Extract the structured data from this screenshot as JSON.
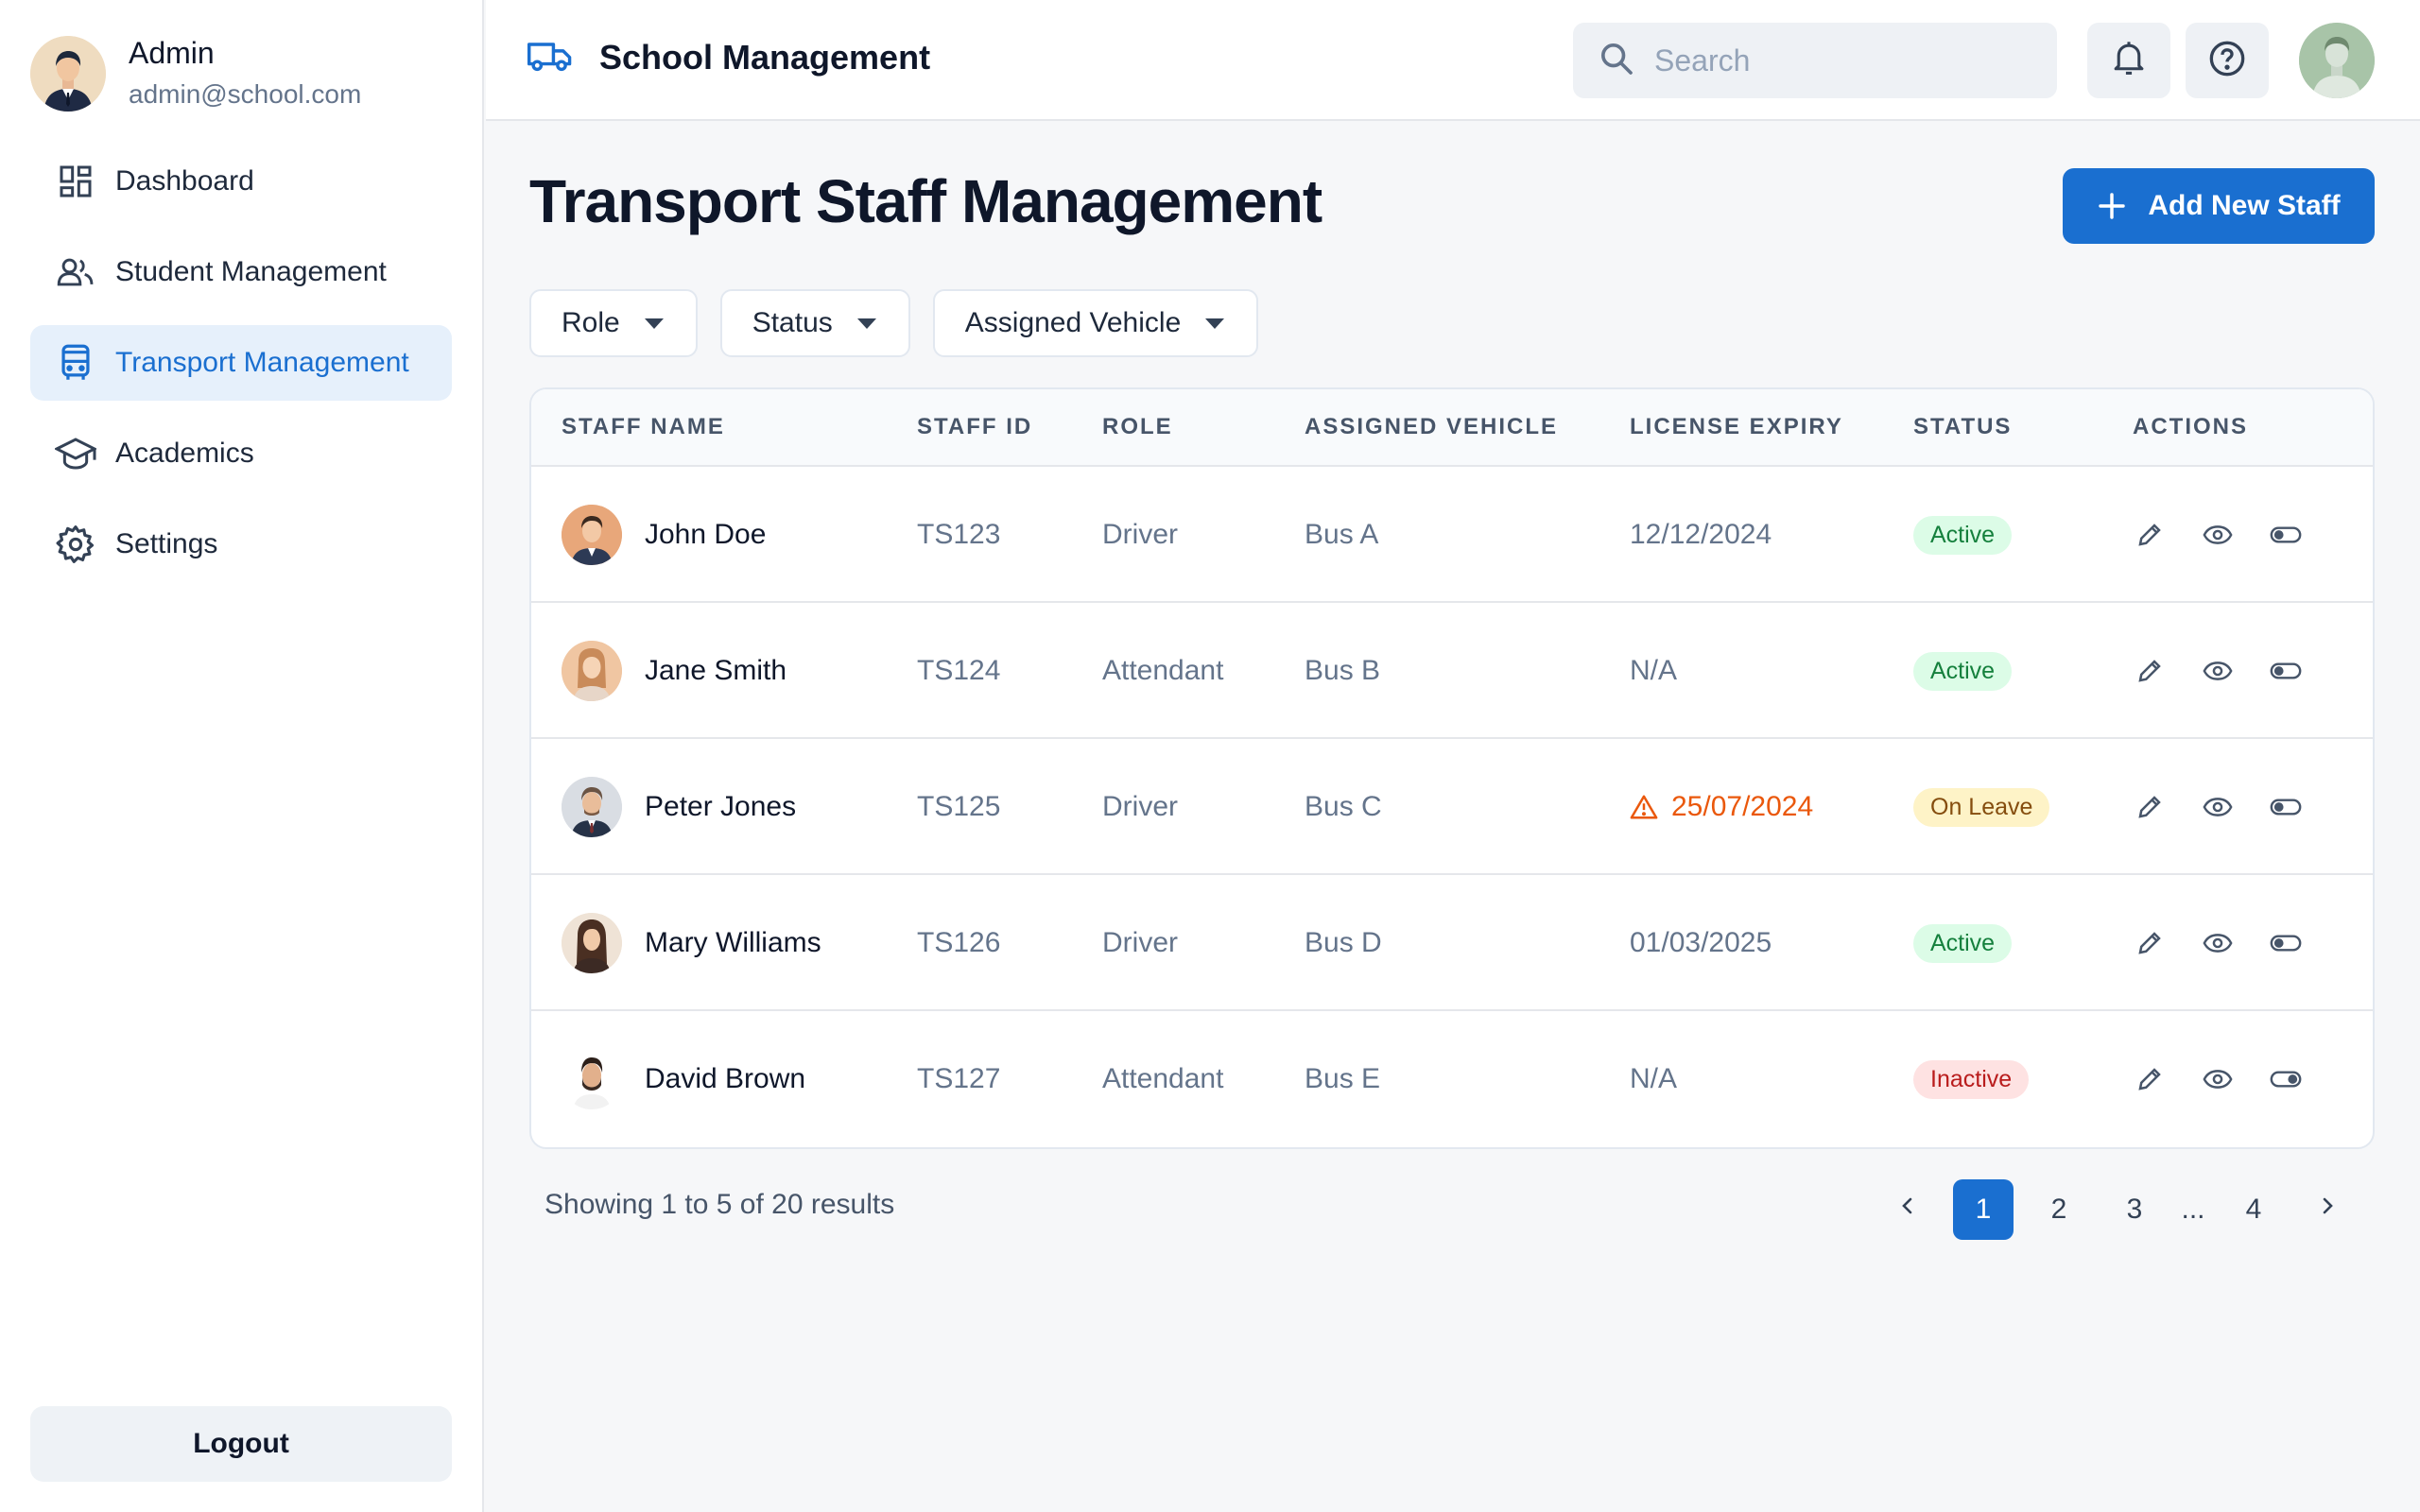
{
  "sidebar": {
    "user": {
      "name": "Admin",
      "email": "admin@school.com"
    },
    "items": [
      {
        "label": "Dashboard",
        "icon": "dashboard-icon"
      },
      {
        "label": "Student Management",
        "icon": "users-icon"
      },
      {
        "label": "Transport Management",
        "icon": "bus-icon"
      },
      {
        "label": "Academics",
        "icon": "graduation-cap-icon"
      },
      {
        "label": "Settings",
        "icon": "gear-icon"
      }
    ],
    "active_index": 2,
    "logout_label": "Logout"
  },
  "header": {
    "title": "School Management",
    "logo_icon": "truck-icon",
    "search_placeholder": "Search"
  },
  "main": {
    "title": "Transport Staff Management",
    "add_button_label": "Add New Staff",
    "filters": [
      "Role",
      "Status",
      "Assigned Vehicle"
    ],
    "table": {
      "columns": [
        "STAFF NAME",
        "STAFF ID",
        "ROLE",
        "ASSIGNED VEHICLE",
        "LICENSE EXPIRY",
        "STATUS",
        "ACTIONS"
      ],
      "rows": [
        {
          "name": "John Doe",
          "id": "TS123",
          "role": "Driver",
          "vehicle": "Bus A",
          "expiry": "12/12/2024",
          "expiry_warning": false,
          "status": "Active"
        },
        {
          "name": "Jane Smith",
          "id": "TS124",
          "role": "Attendant",
          "vehicle": "Bus B",
          "expiry": "N/A",
          "expiry_warning": false,
          "status": "Active"
        },
        {
          "name": "Peter Jones",
          "id": "TS125",
          "role": "Driver",
          "vehicle": "Bus C",
          "expiry": "25/07/2024",
          "expiry_warning": true,
          "status": "On Leave"
        },
        {
          "name": "Mary Williams",
          "id": "TS126",
          "role": "Driver",
          "vehicle": "Bus D",
          "expiry": "01/03/2025",
          "expiry_warning": false,
          "status": "Active"
        },
        {
          "name": "David Brown",
          "id": "TS127",
          "role": "Attendant",
          "vehicle": "Bus E",
          "expiry": "N/A",
          "expiry_warning": false,
          "status": "Inactive"
        }
      ]
    },
    "pagination": {
      "summary": "Showing 1 to 5 of 20 results",
      "pages": [
        "1",
        "2",
        "3",
        "...",
        "4"
      ],
      "current": "1"
    }
  },
  "colors": {
    "accent": "#1a6fd0",
    "active_badge": "#dcfce7",
    "leave_badge": "#fef3c7",
    "inactive_badge": "#fee2e2",
    "warning": "#ea580c"
  }
}
